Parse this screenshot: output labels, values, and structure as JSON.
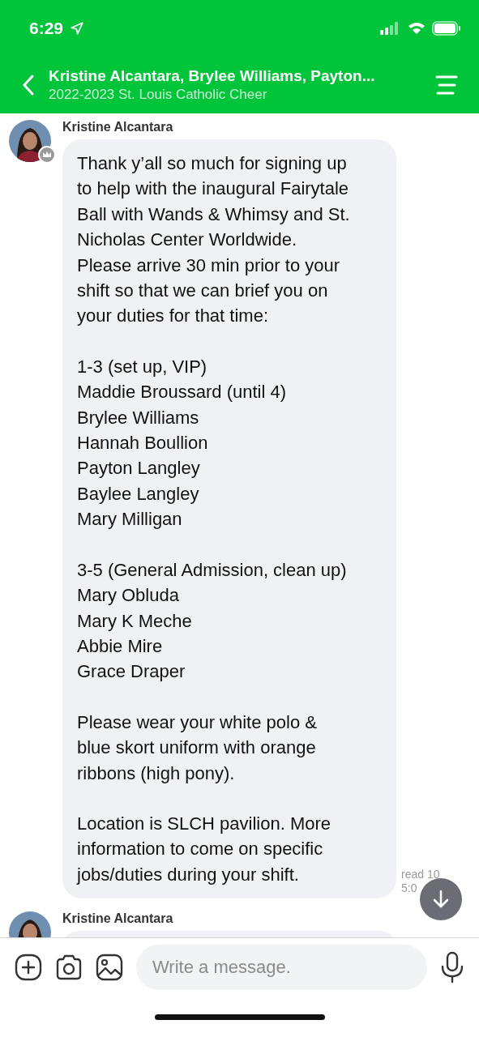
{
  "status_bar": {
    "time": "6:29"
  },
  "header": {
    "title": "Kristine Alcantara, Brylee Williams, Payton...",
    "subtitle": "2022-2023 St. Louis Catholic Cheer"
  },
  "messages": [
    {
      "sender": "Kristine Alcantara",
      "admin": true,
      "paragraphs": [
        [
          "Thank y’all so much for signing up",
          "to help with the inaugural Fairytale",
          "Ball with Wands & Whimsy and St.",
          "Nicholas Center Worldwide.",
          "Please arrive 30 min prior to your",
          "shift so that we can brief you on",
          "your duties for that time:"
        ],
        [
          "1-3 (set up, VIP)",
          "Maddie Broussard (until 4)",
          "Brylee Williams",
          "Hannah Boullion",
          "Payton Langley",
          "Baylee Langley",
          "Mary Milligan"
        ],
        [
          "3-5 (General Admission, clean up)",
          "Mary Obluda",
          "Mary K Meche",
          "Abbie Mire",
          "Grace Draper"
        ],
        [
          "Please wear your white polo &",
          "blue skort uniform with orange",
          "ribbons (high pony)."
        ],
        [
          "Location is SLCH pavilion. More",
          "information to come on specific",
          "jobs/duties during your shift."
        ]
      ],
      "receipt": [
        "read 10",
        "5:0"
      ]
    },
    {
      "sender": "Kristine Alcantara"
    }
  ],
  "composer": {
    "placeholder": "Write a message."
  }
}
